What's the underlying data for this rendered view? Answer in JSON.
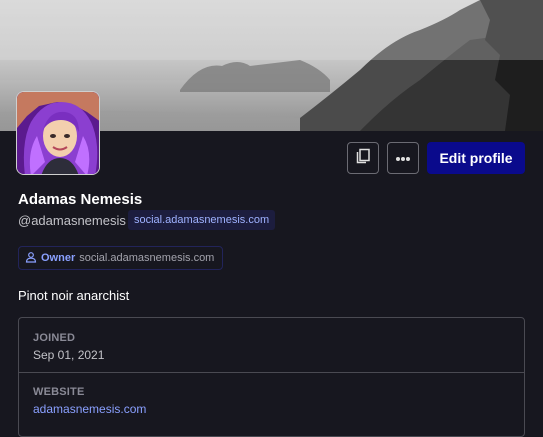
{
  "profile": {
    "display_name": "Adamas Nemesis",
    "handle": "@adamasnemesis",
    "domain": "social.adamasnemesis.com",
    "bio": "Pinot noir anarchist"
  },
  "role": {
    "label": "Owner",
    "domain": "social.adamasnemesis.com",
    "icon": "person-icon"
  },
  "actions": {
    "copy_icon": "copy-icon",
    "more_icon": "more-icon",
    "edit_label": "Edit profile"
  },
  "fields": [
    {
      "label": "JOINED",
      "value": "Sep 01, 2021"
    },
    {
      "label": "WEBSITE",
      "value": "adamasnemesis.com"
    }
  ],
  "colors": {
    "background": "#17171f",
    "accent": "#0a0a8c",
    "link": "#8aa0ff",
    "border": "#4a4a52"
  }
}
